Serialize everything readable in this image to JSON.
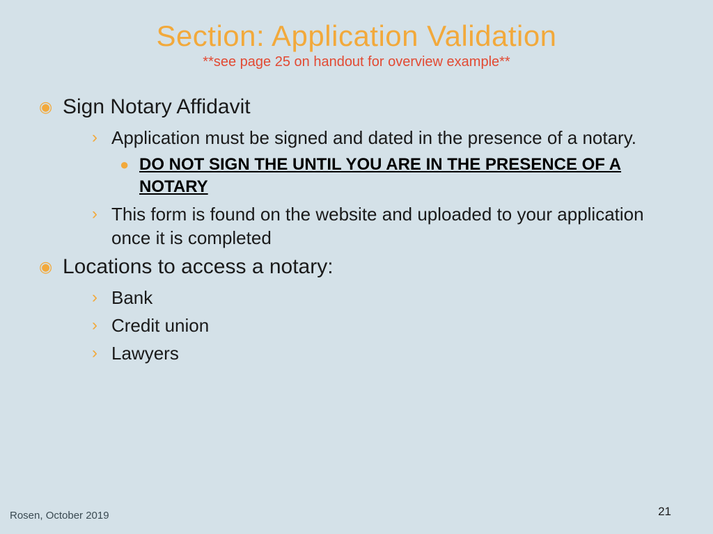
{
  "title": "Section: Application Validation",
  "subtitle": "**see page 25 on handout for overview example**",
  "bullets": {
    "b1": "Sign Notary Affidavit",
    "b1a": "Application must be signed and dated in the presence of a notary.",
    "b1a1": "DO NOT SIGN THE UNTIL YOU ARE IN THE PRESENCE OF A NOTARY",
    "b1b": "This form is found on the website and uploaded to your application once it is completed",
    "b2": "Locations to access a notary:",
    "b2a": "Bank",
    "b2b": "Credit union",
    "b2c": "Lawyers"
  },
  "footer": {
    "author": "Rosen, October 2019",
    "page": "21"
  }
}
